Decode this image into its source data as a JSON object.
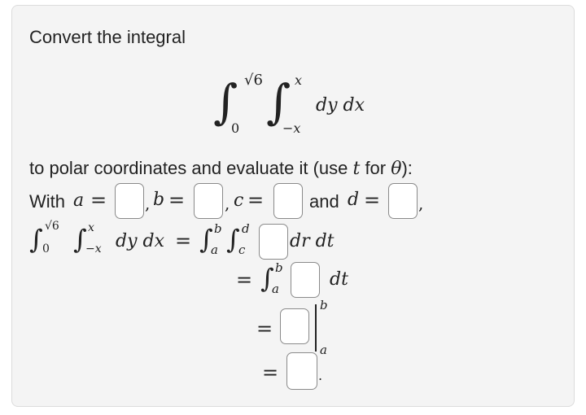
{
  "prompt": {
    "intro": "Convert the integral",
    "instruction_pre": "to polar coordinates and evaluate it (use ",
    "instruction_var": "t",
    "instruction_mid": " for ",
    "instruction_theta": "θ",
    "instruction_post": "):",
    "with_label": "With",
    "and_label": "and"
  },
  "integral": {
    "outer_lower": "0",
    "outer_upper": "√6",
    "inner_lower": "−x",
    "inner_upper": "x",
    "differentials": "dy dx"
  },
  "polar": {
    "var_a": "a",
    "var_b": "b",
    "var_c": "c",
    "var_d": "d",
    "equals": "=",
    "comma": ",",
    "period": ".",
    "dr_dt": "dr dt",
    "dt": "dt",
    "eval_upper": "b",
    "eval_lower": "a"
  },
  "inputs": {
    "a_value": "",
    "b_value": "",
    "c_value": "",
    "d_value": "",
    "integrand_rt": "",
    "integrand_t": "",
    "antiderivative": "",
    "final_answer": ""
  }
}
